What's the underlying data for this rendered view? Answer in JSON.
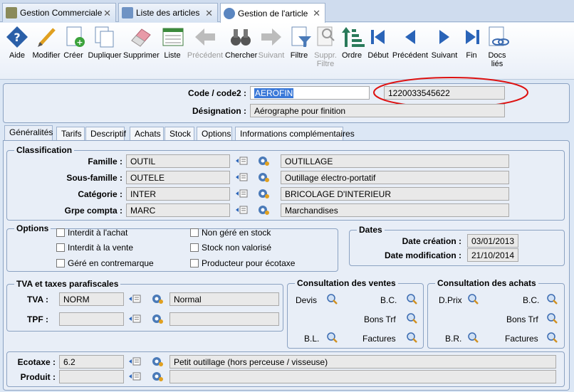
{
  "tabs": [
    {
      "label": "Gestion Commerciale"
    },
    {
      "label": "Liste des articles"
    },
    {
      "label": "Gestion de l'article"
    }
  ],
  "toolbar": {
    "aide": "Aide",
    "modifier": "Modifier",
    "creer": "Créer",
    "dupliquer": "Dupliquer",
    "supprimer": "Supprimer",
    "liste": "Liste",
    "precedent": "Précédent",
    "chercher": "Chercher",
    "suivant": "Suivant",
    "filtre": "Filtre",
    "suppr_filtre_1": "Suppr.",
    "suppr_filtre_2": "Filtre",
    "ordre": "Ordre",
    "debut": "Début",
    "precedent2": "Précédent",
    "suivant2": "Suivant",
    "fin": "Fin",
    "docs_1": "Docs",
    "docs_2": "liés"
  },
  "header": {
    "code_label": "Code / code2 :",
    "code": "AEROFIN",
    "code2": "1220033545622",
    "designation_label": "Désignation :",
    "designation": "Aérographe pour finition"
  },
  "subtabs": [
    "Généralités",
    "Tarifs",
    "Descriptif",
    "Achats",
    "Stock",
    "Options",
    "Informations complémentaires"
  ],
  "classification": {
    "title": "Classification",
    "rows": [
      {
        "label": "Famille :",
        "code": "OUTIL",
        "desc": "OUTILLAGE"
      },
      {
        "label": "Sous-famille :",
        "code": "OUTELE",
        "desc": "Outillage électro-portatif"
      },
      {
        "label": "Catégorie :",
        "code": "INTER",
        "desc": "BRICOLAGE D'INTERIEUR"
      },
      {
        "label": "Grpe compta :",
        "code": "MARC",
        "desc": "Marchandises"
      }
    ]
  },
  "options": {
    "title": "Options",
    "items": [
      "Interdit à l'achat",
      "Interdit à la vente",
      "Géré en contremarque",
      "Non géré en stock",
      "Stock non valorisé",
      "Producteur pour écotaxe"
    ]
  },
  "dates": {
    "title": "Dates",
    "creation_label": "Date création :",
    "creation": "03/01/2013",
    "modif_label": "Date modification :",
    "modif": "21/10/2014"
  },
  "tva": {
    "title": "TVA et taxes parafiscales",
    "tva_label": "TVA :",
    "tva_code": "NORM",
    "tva_desc": "Normal",
    "tpf_label": "TPF :",
    "tpf_code": "",
    "tpf_desc": ""
  },
  "ventes": {
    "title": "Consultation des ventes",
    "devis": "Devis",
    "bc": "B.C.",
    "bons_trf": "Bons Trf",
    "bl": "B.L.",
    "factures": "Factures"
  },
  "achats": {
    "title": "Consultation des achats",
    "dprix": "D.Prix",
    "bc": "B.C.",
    "bons_trf": "Bons Trf",
    "br": "B.R.",
    "factures": "Factures"
  },
  "ecotaxe": {
    "label": "Ecotaxe :",
    "value": "6.2",
    "desc": "Petit outillage (hors perceuse / visseuse)",
    "produit_label": "Produit :",
    "produit": "",
    "produit_desc": ""
  }
}
